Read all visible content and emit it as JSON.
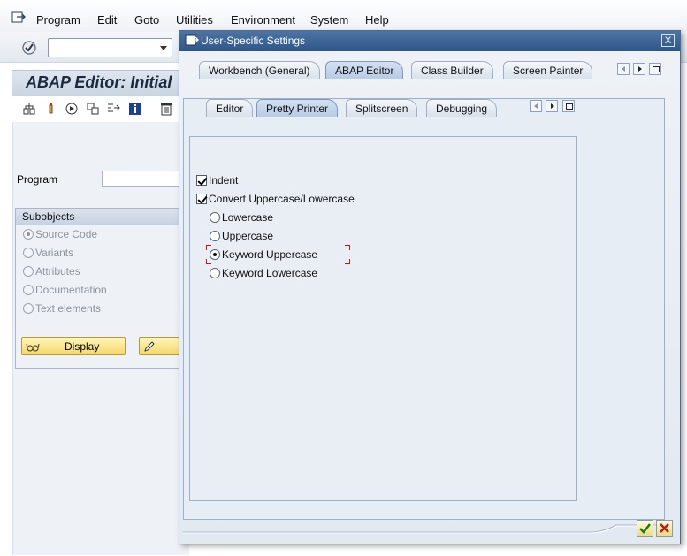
{
  "menubar": {
    "items": [
      {
        "label": "Program"
      },
      {
        "label": "Edit"
      },
      {
        "label": "Goto"
      },
      {
        "label": "Utilities"
      },
      {
        "label": "Environment"
      },
      {
        "label": "System"
      },
      {
        "label": "Help"
      }
    ]
  },
  "command_field": {
    "value": ""
  },
  "screen": {
    "title": "ABAP Editor: Initial",
    "program_label": "Program",
    "program_value": "",
    "subobjects": {
      "title": "Subobjects",
      "options": [
        {
          "label": "Source Code",
          "selected": true
        },
        {
          "label": "Variants",
          "selected": false
        },
        {
          "label": "Attributes",
          "selected": false
        },
        {
          "label": "Documentation",
          "selected": false
        },
        {
          "label": "Text elements",
          "selected": false
        }
      ]
    },
    "display_button": "Display"
  },
  "dialog": {
    "title": "User-Specific Settings",
    "close_label": "X",
    "tabs": [
      {
        "label": "Workbench (General)",
        "active": false
      },
      {
        "label": "ABAP Editor",
        "active": true
      },
      {
        "label": "Class Builder",
        "active": false
      },
      {
        "label": "Screen Painter",
        "active": false
      }
    ],
    "subtabs": [
      {
        "label": "Editor",
        "active": false
      },
      {
        "label": "Pretty Printer",
        "active": true
      },
      {
        "label": "Splitscreen",
        "active": false
      },
      {
        "label": "Debugging",
        "active": false
      }
    ],
    "settings": {
      "indent": {
        "label": "Indent",
        "checked": true
      },
      "convert_case": {
        "label": "Convert Uppercase/Lowercase",
        "checked": true
      },
      "case_options": [
        {
          "label": "Lowercase",
          "selected": false
        },
        {
          "label": "Uppercase",
          "selected": false
        },
        {
          "label": "Keyword Uppercase",
          "selected": true
        },
        {
          "label": "Keyword Lowercase",
          "selected": false
        }
      ]
    }
  },
  "colors": {
    "dialog_title_bg": "#3a6194",
    "focus_marker": "#d01010",
    "yellow_button": "#f3d86a"
  }
}
